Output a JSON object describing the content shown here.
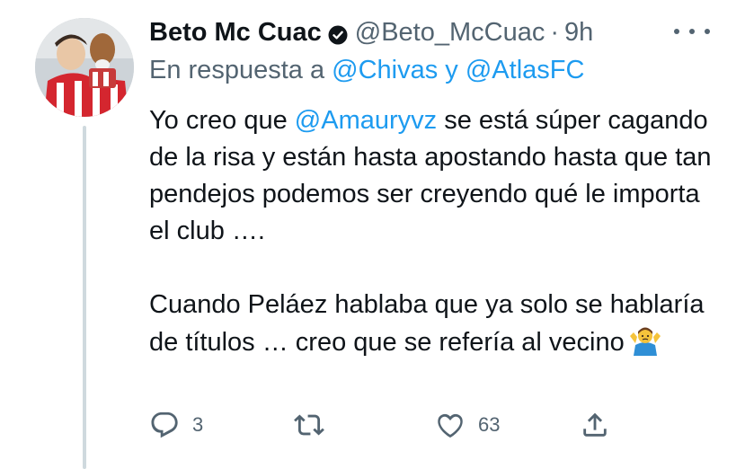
{
  "tweet": {
    "display_name": "Beto Mc Cuac",
    "handle": "@Beto_McCuac",
    "separator": "·",
    "time": "9h",
    "reply_prefix": "En respuesta a",
    "reply_user_1": "@Chivas",
    "reply_conjunction": "y",
    "reply_user_2": "@AtlasFC",
    "body": {
      "p1_before": "Yo creo que",
      "p1_mention": "@Amauryvz",
      "p1_after": "se está súper cagando de la risa y están hasta apostando hasta que tan pendejos podemos ser creyendo qué le importa el club ….",
      "p2_text": "Cuando Peláez hablaba que ya solo se hablaría de títulos … creo que se refería al vecino"
    },
    "emoji": "man-shrugging-emoji",
    "stats": {
      "replies": "3",
      "retweets": "",
      "likes": "63"
    }
  },
  "colors": {
    "text": "#0f1419",
    "secondary": "#536471",
    "link": "#1d9bf0",
    "thread_line": "#cfd9de"
  },
  "icons": [
    "verified-badge-icon",
    "more-icon",
    "reply-icon",
    "retweet-icon",
    "like-icon",
    "share-icon"
  ]
}
